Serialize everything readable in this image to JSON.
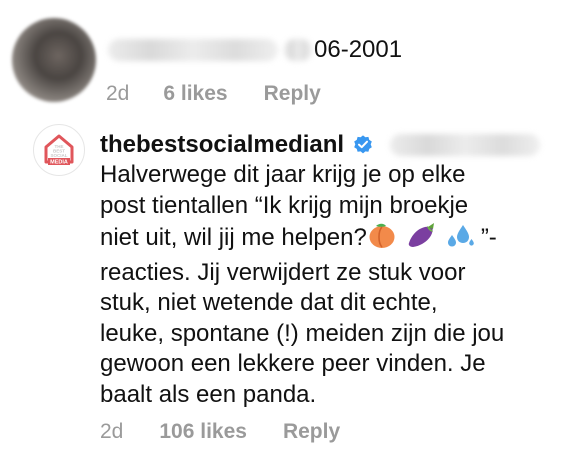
{
  "comments": [
    {
      "username_visible": "06-2001",
      "time": "2d",
      "likes": "6 likes",
      "reply": "Reply"
    },
    {
      "username": "thebestsocialmedianl",
      "avatar_text": [
        "THE",
        "BEST",
        "SOCIAL",
        "MEDIA"
      ],
      "verified_icon": "verified-badge-icon",
      "text_lines": [
        "Halverwege dit jaar krijg je op elke",
        "post tientallen “Ik krijg mijn broekje",
        "niet uit, wil jij me helpen?",
        "”-",
        "reacties. Jij verwijdert ze stuk voor",
        "stuk, niet wetende dat dit echte,",
        "leuke, spontane (!) meiden zijn die jou",
        "gewoon een lekkere peer vinden. Je",
        "baalt als een panda."
      ],
      "emojis": [
        "peach-emoji",
        "eggplant-emoji",
        "sweat-droplets-emoji"
      ],
      "time": "2d",
      "likes": "106 likes",
      "reply": "Reply"
    }
  ],
  "colors": {
    "meta_gray": "#9a9a9a",
    "verified_blue": "#3897f0",
    "brand_red": "#e0565b"
  }
}
